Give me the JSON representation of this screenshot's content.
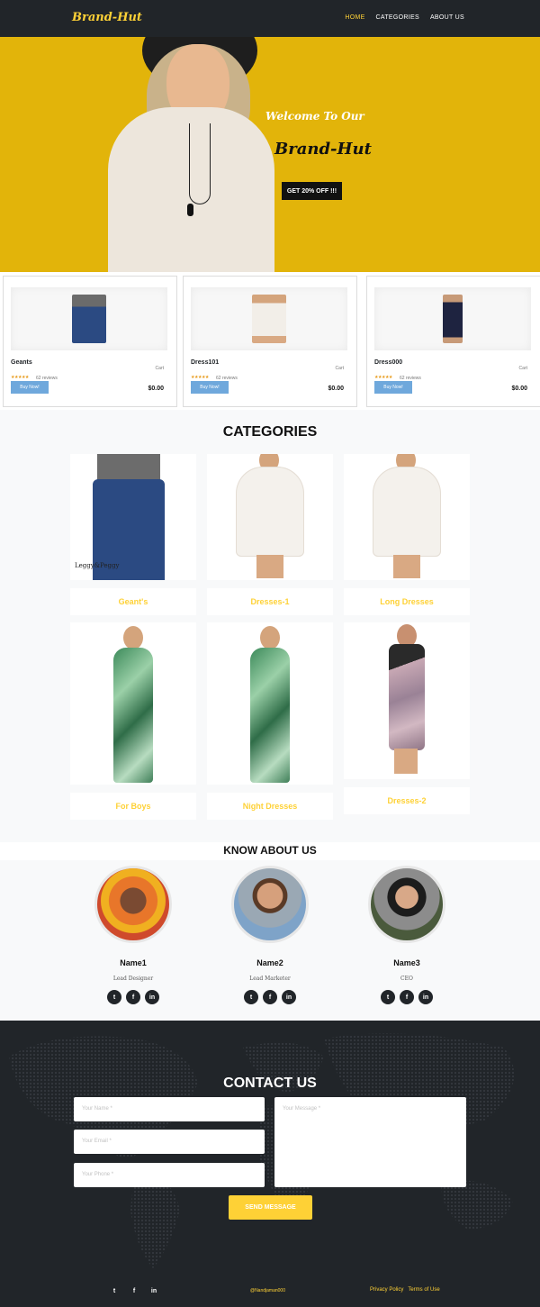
{
  "nav": {
    "brand": "Brand-Hut",
    "links": [
      "HOME",
      "CATEGORIES",
      "ABOUT US"
    ]
  },
  "hero": {
    "welcome": "Welcome To Our",
    "brand": "Brand-Hut",
    "cta": "GET 20% OFF !!!"
  },
  "products": [
    {
      "name": "Geants",
      "cart": "Cart",
      "stars": "★★★★★",
      "reviews": "62 reviews",
      "buy": "Buy Now!",
      "price": "$0.00"
    },
    {
      "name": "Dress101",
      "cart": "Cart",
      "stars": "★★★★★",
      "reviews": "62 reviews",
      "buy": "Buy Now!",
      "price": "$0.00"
    },
    {
      "name": "Dress000",
      "cart": "Cart",
      "stars": "★★★★★",
      "reviews": "62 reviews",
      "buy": "Buy Now!",
      "price": "$0.00"
    }
  ],
  "categories": {
    "title": "CATEGORIES",
    "image_text": "Leggy&Peggy",
    "items": [
      "Geant's",
      "Dresses-1",
      "Long Dresses",
      "For Boys",
      "Night Dresses",
      "Dresses-2"
    ]
  },
  "about": {
    "title": "KNOW ABOUT US",
    "members": [
      {
        "name": "Name1",
        "role": "Lead Designer"
      },
      {
        "name": "Name2",
        "role": "Lead Marketer"
      },
      {
        "name": "Name3",
        "role": "CEO"
      }
    ]
  },
  "contact": {
    "title": "CONTACT US",
    "name_placeholder": "Your Name *",
    "email_placeholder": "Your Email *",
    "phone_placeholder": "Your Phone *",
    "message_placeholder": "Your Message *",
    "send": "SEND MESSAGE"
  },
  "footer": {
    "copyright": "@Nandjaman000",
    "privacy": "Privacy Policy",
    "terms": "Terms of Use"
  },
  "icons": {
    "twitter": "twitter-icon",
    "facebook": "facebook-icon",
    "linkedin": "linkedin-icon"
  },
  "colors": {
    "accent": "#fed136",
    "dark": "#212529",
    "hero_bg": "#e2b40a",
    "buy_button": "#6fa8dc"
  }
}
